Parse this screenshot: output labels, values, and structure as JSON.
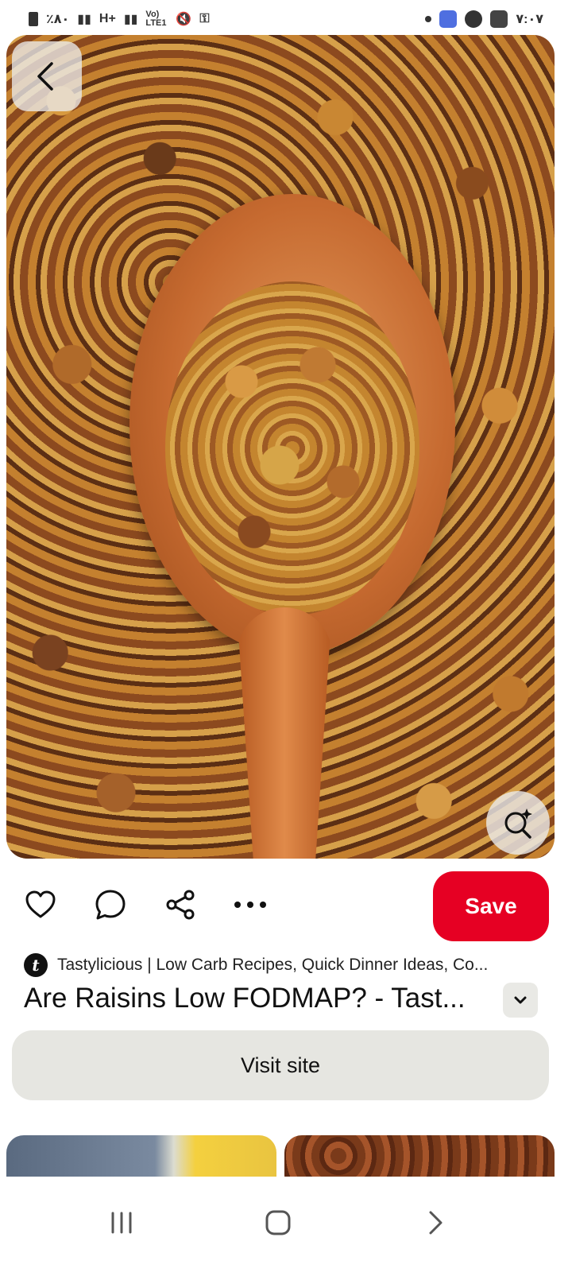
{
  "status_bar": {
    "left_text": "٪٨٠",
    "network_1": "H+",
    "network_2": "Vo) LTE1",
    "time": "٧:٠٧"
  },
  "hero": {
    "back_icon": "chevron-left-icon",
    "visual_search_icon": "visual-search-sparkle-icon"
  },
  "actions": {
    "like_icon": "heart-icon",
    "comment_icon": "comment-icon",
    "share_icon": "share-icon",
    "more_icon": "more-dots-icon",
    "save_label": "Save",
    "save_color": "#e60023"
  },
  "pin": {
    "source_initial": "t",
    "source_name": "Tastylicious | Low Carb Recipes, Quick Dinner Ideas, Co...",
    "title": "Are Raisins Low FODMAP? - Tast...",
    "expand_icon": "chevron-down-icon",
    "visit_label": "Visit site"
  },
  "navbar": {
    "recents_icon": "recents-icon",
    "home_icon": "home-icon",
    "back_icon": "back-icon"
  }
}
